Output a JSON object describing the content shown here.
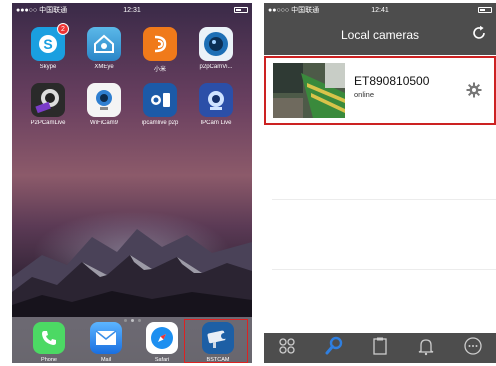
{
  "left_phone": {
    "status": {
      "carrier": "●●●○○ 中国联通",
      "time": "12:31"
    },
    "apps": [
      {
        "name": "Skype",
        "badge": "2",
        "icon": "skype-icon",
        "color": "#1a9fe0"
      },
      {
        "name": "XMEye",
        "icon": "xmeye-icon",
        "color": "#3aa0d8"
      },
      {
        "name": "小米",
        "icon": "xiaomi-icon",
        "color": "#f07a1a"
      },
      {
        "name": "p2pCamVi...",
        "icon": "camera-lens-icon",
        "color": "#eaf2f8"
      },
      {
        "name": "P2PCamLive",
        "icon": "p2pcamlive-icon",
        "color": "#2a2a2a"
      },
      {
        "name": "WiFiCam9",
        "icon": "webcam-icon",
        "color": "#f4f4f4"
      },
      {
        "name": "ipcamlive p2p",
        "icon": "ipcam-icon",
        "color": "#1c5aa8"
      },
      {
        "name": "IPCam Live",
        "icon": "ipcam-live-icon",
        "color": "#2b4fa8"
      }
    ],
    "dock": [
      {
        "name": "Phone",
        "icon": "phone-icon",
        "color": "#4cd964"
      },
      {
        "name": "Mail",
        "icon": "mail-icon",
        "color": "#2a8ff0"
      },
      {
        "name": "Safari",
        "icon": "safari-compass-icon",
        "color": "#ffffff"
      },
      {
        "name": "BSTCAM",
        "icon": "bstcam-icon",
        "color": "#1d5fa5"
      }
    ],
    "highlight_color": "#d22222"
  },
  "right_phone": {
    "status": {
      "carrier": "●●○○○ 中国联通",
      "time": "12:41"
    },
    "title": "Local cameras",
    "camera": {
      "name": "ET890810500",
      "status": "online"
    },
    "highlight_color": "#cc2222",
    "tabs": [
      {
        "icon": "devices-icon"
      },
      {
        "icon": "search-icon",
        "active": true
      },
      {
        "icon": "clipboard-icon"
      },
      {
        "icon": "bell-icon"
      },
      {
        "icon": "more-icon"
      }
    ]
  }
}
